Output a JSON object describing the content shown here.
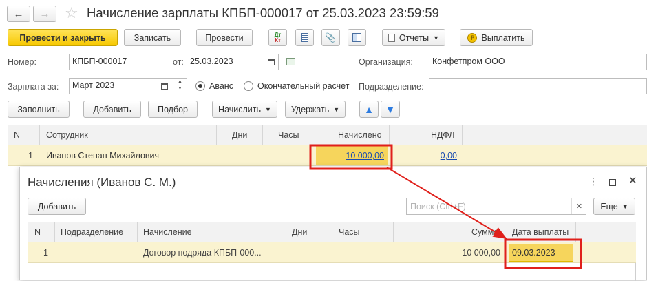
{
  "window": {
    "title": "Начисление зарплаты КПБП-000017 от 25.03.2023 23:59:59"
  },
  "toolbar": {
    "post_close_label": "Провести и закрыть",
    "save_label": "Записать",
    "post_label": "Провести",
    "dt_label": "Дт",
    "kt_label": "Кт",
    "reports_label": "Отчеты",
    "pay_label": "Выплатить"
  },
  "form": {
    "number_label": "Номер:",
    "number_value": "КПБП-000017",
    "date_label": "от:",
    "date_value": "25.03.2023",
    "org_label": "Организация:",
    "org_value": "Конфетпром ООО",
    "salary_for_label": "Зарплата за:",
    "salary_for_value": "Март 2023",
    "advance_label": "Аванс",
    "final_label": "Окончательный расчет",
    "division_label": "Подразделение:",
    "division_value": ""
  },
  "actions": {
    "fill_label": "Заполнить",
    "add_label": "Добавить",
    "select_label": "Подбор",
    "accrue_label": "Начислить",
    "withhold_label": "Удержать"
  },
  "main_table": {
    "headers": [
      "N",
      "Сотрудник",
      "Дни",
      "Часы",
      "Начислено",
      "НДФЛ"
    ],
    "rows": [
      {
        "n": "1",
        "employee": "Иванов Степан Михайлович",
        "days": "",
        "hours": "",
        "accrued": "10 000,00",
        "ndfl": "0,00"
      }
    ]
  },
  "popup": {
    "title": "Начисления (Иванов С. М.)",
    "add_label": "Добавить",
    "search_placeholder": "Поиск (Ctrl+F)",
    "more_label": "Еще",
    "headers": [
      "N",
      "Подразделение",
      "Начисление",
      "Дни",
      "Часы",
      "Сумма",
      "Дата выплаты"
    ],
    "rows": [
      {
        "n": "1",
        "division": "",
        "accrual": "Договор подряда КПБП-000...",
        "days": "",
        "hours": "",
        "sum": "10 000,00",
        "pay_date": "09.03.2023"
      }
    ]
  },
  "colors": {
    "accent_yellow": "#f7c800",
    "selected_row": "#faf3d0",
    "annotation_red": "#e0201b",
    "link_blue": "#1a4bb0"
  }
}
